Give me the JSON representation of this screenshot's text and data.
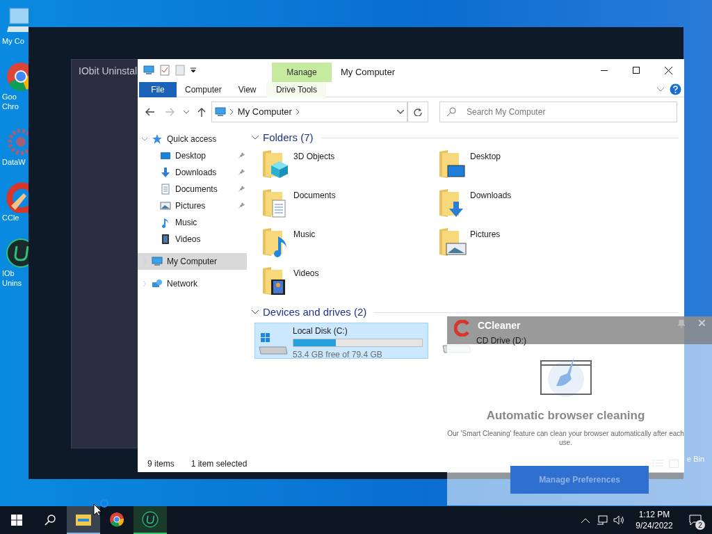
{
  "desktop_icons": [
    {
      "label": "My Co",
      "kind": "computer"
    },
    {
      "label": "Goo\nChro",
      "kind": "chrome"
    },
    {
      "label": "DataW",
      "kind": "gear"
    },
    {
      "label": "CCle",
      "kind": "ccleaner"
    },
    {
      "label": "IOb\nUnins",
      "kind": "iobit"
    }
  ],
  "recycle_bin": {
    "label": "e Bin"
  },
  "iobit_window": {
    "title": "IObit Uninstal"
  },
  "explorer": {
    "title": "My Computer",
    "context_header": "Manage",
    "ribbon_tabs": [
      {
        "label": "File",
        "kind": "file"
      },
      {
        "label": "Computer",
        "kind": "tab"
      },
      {
        "label": "View",
        "kind": "tab"
      },
      {
        "label": "Drive Tools",
        "kind": "context"
      }
    ],
    "address": {
      "path": "My Computer"
    },
    "search": {
      "placeholder": "Search My Computer"
    },
    "nav": [
      {
        "label": "Quick access",
        "kind": "star",
        "expanded": true,
        "selected": false,
        "children": [
          {
            "label": "Desktop",
            "kind": "desktop",
            "pinned": true,
            "selected": false
          },
          {
            "label": "Downloads",
            "kind": "downloads",
            "pinned": true,
            "selected": false
          },
          {
            "label": "Documents",
            "kind": "documents",
            "pinned": true,
            "selected": false
          },
          {
            "label": "Pictures",
            "kind": "pictures",
            "pinned": true,
            "selected": false
          },
          {
            "label": "Music",
            "kind": "music",
            "pinned": false,
            "selected": false
          },
          {
            "label": "Videos",
            "kind": "videos",
            "pinned": false,
            "selected": false
          }
        ]
      },
      {
        "label": "My Computer",
        "kind": "computer",
        "expanded": false,
        "selected": true
      },
      {
        "label": "Network",
        "kind": "network",
        "expanded": false,
        "selected": false
      }
    ],
    "folders": {
      "heading": "Folders (7)",
      "items": [
        {
          "label": "3D Objects",
          "kind": "cube"
        },
        {
          "label": "Desktop",
          "kind": "desktop"
        },
        {
          "label": "Documents",
          "kind": "documents"
        },
        {
          "label": "Downloads",
          "kind": "downloads"
        },
        {
          "label": "Music",
          "kind": "music"
        },
        {
          "label": "Pictures",
          "kind": "pictures"
        },
        {
          "label": "Videos",
          "kind": "videos"
        }
      ]
    },
    "drives": {
      "heading": "Devices and drives (2)",
      "items": [
        {
          "label": "Local Disk (C:)",
          "kind": "disk",
          "free": "53.4 GB free of 79.4 GB",
          "level": 0.33,
          "selected": true
        },
        {
          "label": "CD Drive (D:)",
          "kind": "cd",
          "selected": false
        }
      ]
    },
    "status": [
      "9 items",
      "1 item selected"
    ]
  },
  "ccleaner": {
    "title": "CCleaner",
    "heading": "Automatic browser cleaning",
    "body": "Our 'Smart Cleaning' feature can clean your browser automatically after each use.",
    "button": "Manage Preferences"
  },
  "taskbar": {
    "apps": [
      {
        "kind": "explorer",
        "active": true,
        "running": true
      },
      {
        "kind": "chrome",
        "active": false,
        "running": false
      },
      {
        "kind": "iobit",
        "active": false,
        "running": true
      }
    ],
    "time": "1:12 PM",
    "date": "9/24/2022",
    "notifications": "2"
  }
}
